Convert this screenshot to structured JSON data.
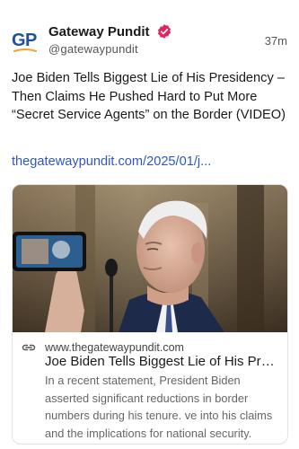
{
  "post": {
    "author": {
      "avatar_text": "GP",
      "name": "Gateway Pundit",
      "handle": "@gatewaypundit",
      "verified_icon": "verified-badge-icon"
    },
    "time": "37m",
    "text": "Joe Biden Tells Biggest Lie of His Presidency – Then Claims He Pushed Hard to Put More “Secret Service Agents” on the Border (VIDEO)",
    "link": "thegatewaypundit.com/2025/01/j..."
  },
  "card": {
    "image_alt": "Joe Biden speaking to press with a phone recording him",
    "link_icon": "link-icon",
    "domain": "www.thegatewaypundit.com",
    "title": "Joe Biden Tells Biggest Lie of His Presidency",
    "description": "In a recent statement, President Biden asserted significant reductions in border numbers during his tenure. ve into his claims and the implications for national security."
  },
  "colors": {
    "link": "#2f56c6",
    "verified": "#e0245e",
    "brand_blue": "#1f4fa3",
    "brand_orange": "#f2a23a"
  }
}
